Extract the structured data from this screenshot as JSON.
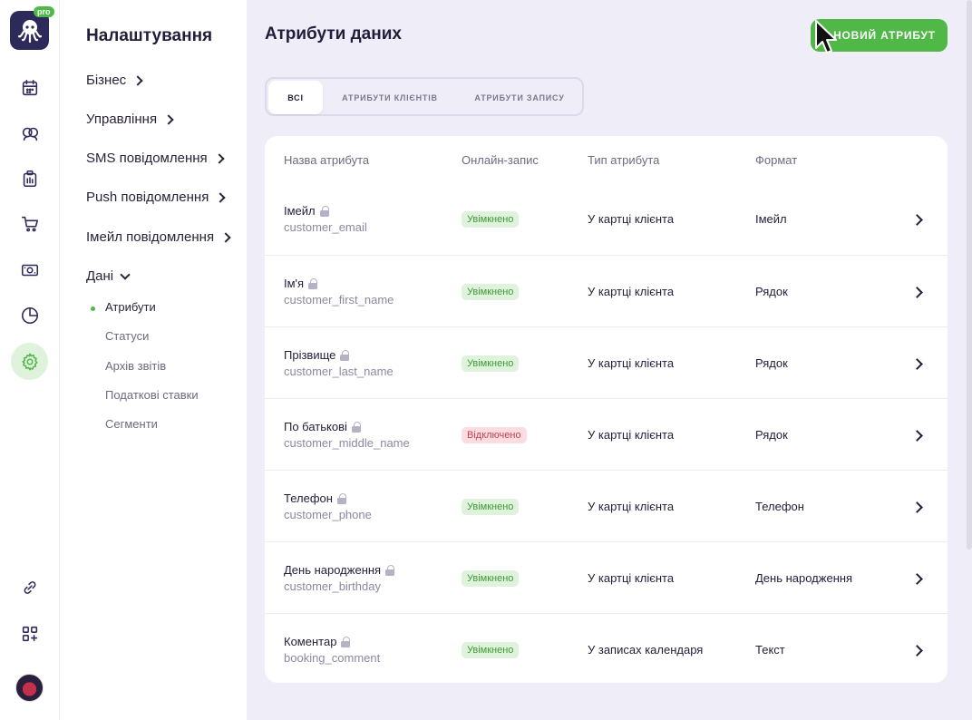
{
  "app": {
    "pro_badge": "pro"
  },
  "rail": {
    "items": [
      {
        "icon": "calendar-icon"
      },
      {
        "icon": "clients-icon"
      },
      {
        "icon": "clipboard-icon"
      },
      {
        "icon": "cart-icon"
      },
      {
        "icon": "money-icon"
      },
      {
        "icon": "analytics-icon"
      },
      {
        "icon": "settings-icon",
        "active": true
      },
      {
        "icon": "link-icon"
      },
      {
        "icon": "apps-add-icon"
      }
    ]
  },
  "nav": {
    "title": "Налаштування",
    "items": [
      {
        "label": "Бізнес"
      },
      {
        "label": "Управління"
      },
      {
        "label": "SMS повідомлення"
      },
      {
        "label": "Push повідомлення"
      },
      {
        "label": "Імейл повідомлення"
      },
      {
        "label": "Дані",
        "expanded": true
      }
    ],
    "sub_items": [
      {
        "label": "Атрибути",
        "active": true
      },
      {
        "label": "Статуси"
      },
      {
        "label": "Архів звітів"
      },
      {
        "label": "Податкові ставки"
      },
      {
        "label": "Сегменти"
      }
    ]
  },
  "main": {
    "title": "Атрибути даних",
    "new_button": "+ НОВИЙ АТРИБУТ",
    "tabs": [
      {
        "label": "всі",
        "active": true
      },
      {
        "label": "атрибути клієнтів"
      },
      {
        "label": "атрибути запису"
      }
    ],
    "columns": [
      "Назва атрибута",
      "Онлайн-запис",
      "Тип атрибута",
      "Формат"
    ],
    "rows": [
      {
        "name": "Імейл",
        "key": "customer_email",
        "status": "Увімкнено",
        "enabled": true,
        "type": "У картці клієнта",
        "format": "Імейл"
      },
      {
        "name": "Ім'я",
        "key": "customer_first_name",
        "status": "Увімкнено",
        "enabled": true,
        "type": "У картці клієнта",
        "format": "Рядок"
      },
      {
        "name": "Прізвище",
        "key": "customer_last_name",
        "status": "Увімкнено",
        "enabled": true,
        "type": "У картці клієнта",
        "format": "Рядок"
      },
      {
        "name": "По батькові",
        "key": "customer_middle_name",
        "status": "Відключено",
        "enabled": false,
        "type": "У картці клієнта",
        "format": "Рядок"
      },
      {
        "name": "Телефон",
        "key": "customer_phone",
        "status": "Увімкнено",
        "enabled": true,
        "type": "У картці клієнта",
        "format": "Телефон"
      },
      {
        "name": "День народження",
        "key": "customer_birthday",
        "status": "Увімкнено",
        "enabled": true,
        "type": "У картці клієнта",
        "format": "День народження"
      },
      {
        "name": "Коментар",
        "key": "booking_comment",
        "status": "Увімкнено",
        "enabled": true,
        "type": "У записах календаря",
        "format": "Текст"
      }
    ]
  },
  "colors": {
    "accent": "#4fb846",
    "brand": "#2d2a5a",
    "off": "#c84054",
    "background": "#efedf8"
  }
}
